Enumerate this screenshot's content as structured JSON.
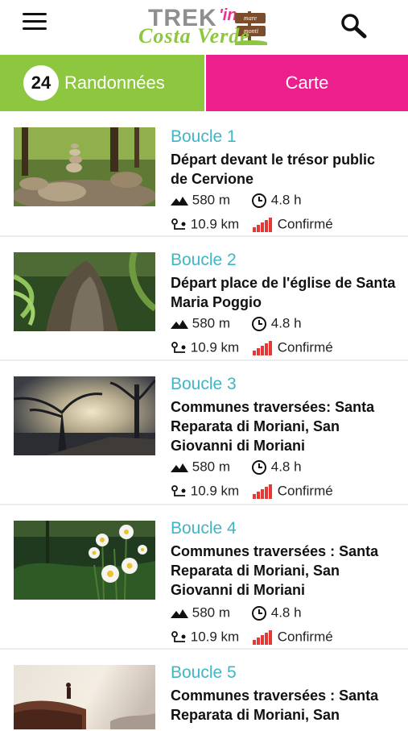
{
  "header": {
    "logo_trek": "TREK",
    "logo_in": "'in",
    "logo_sign_top": "mare",
    "logo_sign_bottom": "monti",
    "logo_sub": "Costa Verde"
  },
  "tabs": {
    "count": "24",
    "hikes_label": "Randonnées",
    "map_label": "Carte",
    "hikes_color": "#8dc63f",
    "map_color": "#ec1f8c"
  },
  "colors": {
    "title": "#3fb6c6",
    "level": "#e53935"
  },
  "hikes": [
    {
      "title": "Boucle 1",
      "desc_lines": [
        "Départ devant le trésor public",
        "de Cervione"
      ],
      "elevation": "580 m",
      "duration": "4.8 h",
      "distance": "10.9 km",
      "level": "Confirmé"
    },
    {
      "title": "Boucle 2",
      "desc_lines": [
        "Départ place de l'église de Santa",
        "Maria Poggio"
      ],
      "elevation": "580 m",
      "duration": "4.8 h",
      "distance": "10.9 km",
      "level": "Confirmé"
    },
    {
      "title": "Boucle 3",
      "desc_lines": [
        "Communes traversées: Santa",
        "Reparata di Moriani, San",
        "Giovanni di Moriani"
      ],
      "elevation": "580 m",
      "duration": "4.8 h",
      "distance": "10.9 km",
      "level": "Confirmé"
    },
    {
      "title": "Boucle 4",
      "desc_lines": [
        "Communes traversées : Santa",
        "Reparata di Moriani, San",
        "Giovanni di Moriani"
      ],
      "elevation": "580 m",
      "duration": "4.8 h",
      "distance": "10.9 km",
      "level": "Confirmé"
    },
    {
      "title": "Boucle 5",
      "desc_lines": [
        "Communes traversées : Santa",
        "Reparata di Moriani, San"
      ]
    }
  ]
}
